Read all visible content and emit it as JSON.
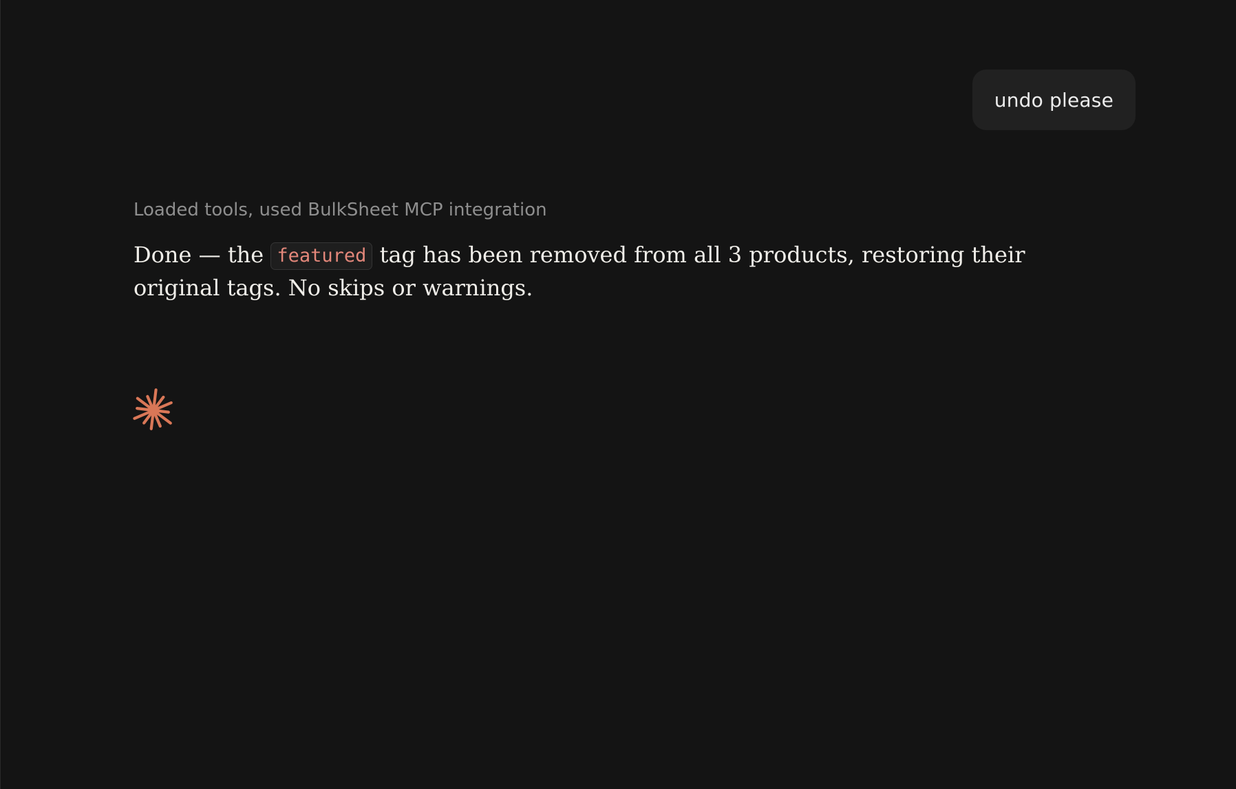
{
  "conversation": {
    "user_message": "undo please",
    "assistant": {
      "tool_status": "Loaded tools, used BulkSheet MCP integration",
      "reply": {
        "before_code": "Done — the ",
        "code": "featured",
        "after_code": " tag has been removed from all 3 products, restoring their original tags. No skips or warnings."
      },
      "activity_indicator": {
        "icon": "spark-icon",
        "color": "#d97757"
      }
    }
  },
  "colors": {
    "background": "#141414",
    "user_bubble": "#212121",
    "code_text": "#e3877a"
  }
}
